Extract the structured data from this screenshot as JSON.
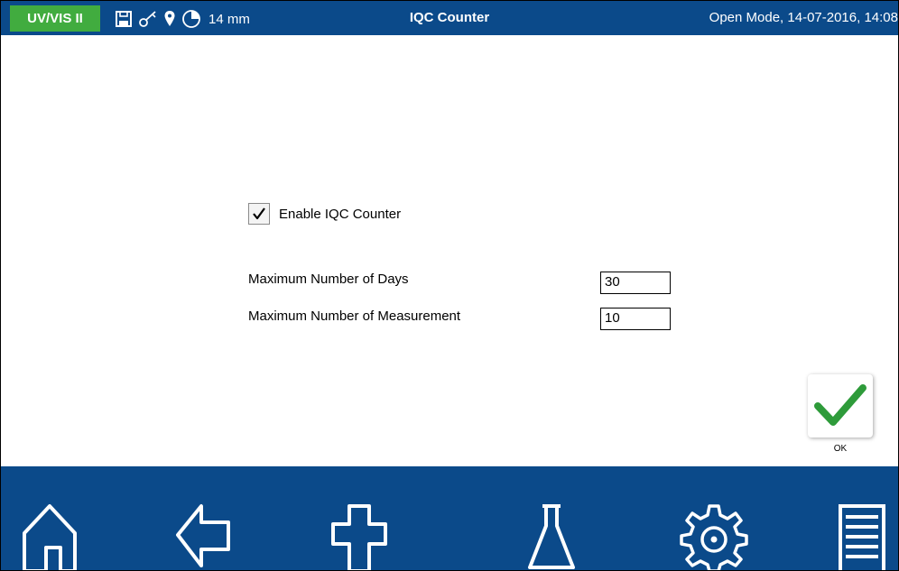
{
  "header": {
    "badge": "UV/VIS II",
    "status_icons": [
      "save-icon",
      "key-icon",
      "location-pin-icon",
      "pie-timer-icon"
    ],
    "cuvette_size": "14 mm",
    "title": "IQC Counter",
    "mode_datetime": "Open Mode, 14-07-2016, 14:08"
  },
  "form": {
    "enable_label": "Enable IQC Counter",
    "enable_checked": true,
    "max_days_label": "Maximum Number of Days",
    "max_days_value": "30",
    "max_measurements_label": "Maximum Number of Measurement",
    "max_measurements_value": "10"
  },
  "ok_button": {
    "label": "OK",
    "icon": "checkmark-icon"
  },
  "toolbar": {
    "buttons": [
      "home-icon",
      "back-arrow-icon",
      "add-icon",
      "flask-icon",
      "settings-gear-icon",
      "menu-list-icon"
    ]
  },
  "colors": {
    "bar_blue": "#0b4a8a",
    "badge_green": "#41ac3f",
    "check_green": "#2e9b3a"
  }
}
